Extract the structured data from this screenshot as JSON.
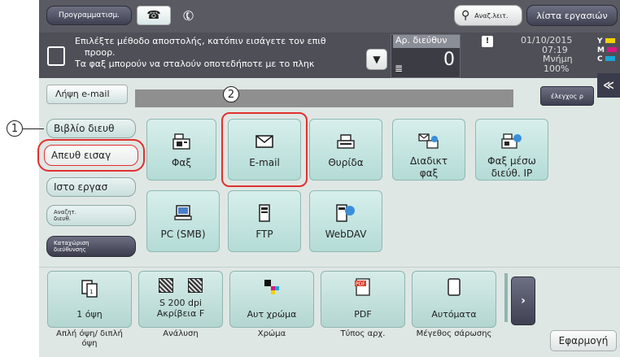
{
  "top": {
    "program_label": "Προγραμματισμ.",
    "search_label": "Αναζ.λειτ.",
    "joblist_label": "λίστα εργασιών"
  },
  "message": {
    "line1": "Επιλέξτε μέθοδο αποστολής, κατόπιν εισάγετε τον επιθ",
    "line2": "προορ.",
    "line3": "Τα φαξ μπορούν να σταλούν οποτεδήποτε με το πληκ",
    "dest_label": "Αρ. διεύθυν",
    "dest_count": "0",
    "date": "01/10/2015",
    "time": "07:19",
    "memory_label": "Μνήμη",
    "memory_value": "100%"
  },
  "toolbar": {
    "receive_email": "Λήψη e-mail",
    "check_label": "έλεγχος ρ"
  },
  "sidebar": {
    "address_book": "Βιβλίο διευθ",
    "direct_input": "Απευθ εισαγ",
    "job_history": "Ιστο εργασ",
    "address_search_line1": "Αναζητ.",
    "address_search_line2": "διευθ.",
    "register_line1": "Καταχώριση",
    "register_line2": "διεύθυνσης"
  },
  "destinations": [
    {
      "label": "Φαξ",
      "icon": "fax-icon"
    },
    {
      "label": "E-mail",
      "icon": "email-icon"
    },
    {
      "label": "Θυρίδα",
      "icon": "user-box-icon"
    },
    {
      "label": "Διαδικτ φαξ",
      "icon": "internet-fax-icon"
    },
    {
      "label": "Φαξ μέσω διεύθ. IP",
      "icon": "ip-fax-icon"
    },
    {
      "label": "PC (SMB)",
      "icon": "pc-smb-icon"
    },
    {
      "label": "FTP",
      "icon": "ftp-icon"
    },
    {
      "label": "WebDAV",
      "icon": "webdav-icon"
    }
  ],
  "settings": [
    {
      "label": "1 όψη",
      "caption": "Απλή όψη/ διπλή όψη"
    },
    {
      "label1": "S 200 dpi",
      "label2": "Ακρίβεια F",
      "caption": "Ανάλυση"
    },
    {
      "label": "Αυτ χρώμα",
      "caption": "Χρώμα"
    },
    {
      "label": "PDF",
      "caption": "Τύπος αρχ."
    },
    {
      "label": "Αυτόματα",
      "caption": "Μέγεθος σάρωσης"
    }
  ],
  "apply_label": "Εφαρμογή",
  "callouts": {
    "one": "1",
    "two": "2"
  },
  "colors": {
    "highlight": "#e0312f",
    "toner_yellow": "#f2d200",
    "toner_magenta": "#d8177f",
    "toner_cyan": "#19a7d6"
  }
}
